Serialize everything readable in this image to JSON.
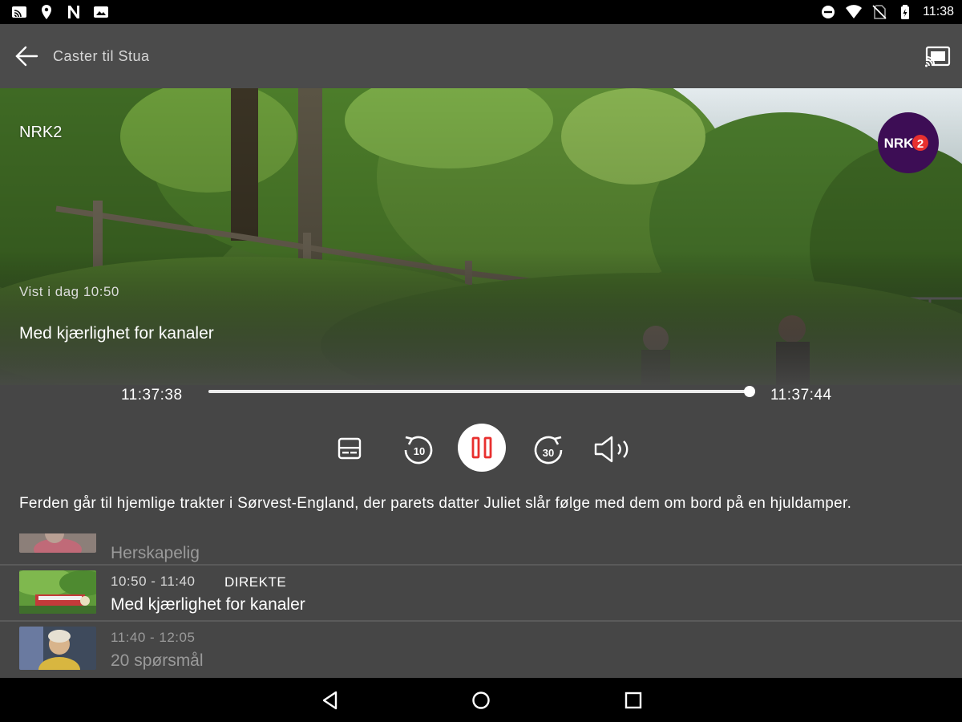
{
  "status_bar": {
    "time": "11:38",
    "left_icons": [
      "cast-status-icon",
      "location-icon",
      "n-app-icon",
      "photo-icon"
    ],
    "right_icons": [
      "do-not-disturb-icon",
      "wifi-icon",
      "no-sim-icon",
      "battery-icon"
    ]
  },
  "app_bar": {
    "title": "Caster til Stua"
  },
  "player": {
    "channel_name": "NRK2",
    "logo_text": "NRK",
    "logo_number": "2",
    "shown_time": "Vist i dag 10:50",
    "program_title": "Med kjærlighet for kanaler",
    "time_start": "11:37:38",
    "time_end": "11:37:44",
    "progress": 1.0,
    "skip_back_seconds": "10",
    "skip_forward_seconds": "30"
  },
  "description": "Ferden går til hjemlige trakter i Sørvest-England, der parets datter Juliet slår følge med dem om bord på en hjuldamper.",
  "schedule": [
    {
      "time": "",
      "live": "",
      "title": "Herskapelig",
      "dimmed": true
    },
    {
      "time": "10:50 - 11:40",
      "live": "DIREKTE",
      "title": "Med kjærlighet for kanaler",
      "dimmed": false
    },
    {
      "time": "11:40 - 12:05",
      "live": "",
      "title": "20 spørsmål",
      "dimmed": true
    }
  ],
  "colors": {
    "accent": "#e8302f",
    "logo_bg": "#3d0d55",
    "background": "#464646"
  }
}
